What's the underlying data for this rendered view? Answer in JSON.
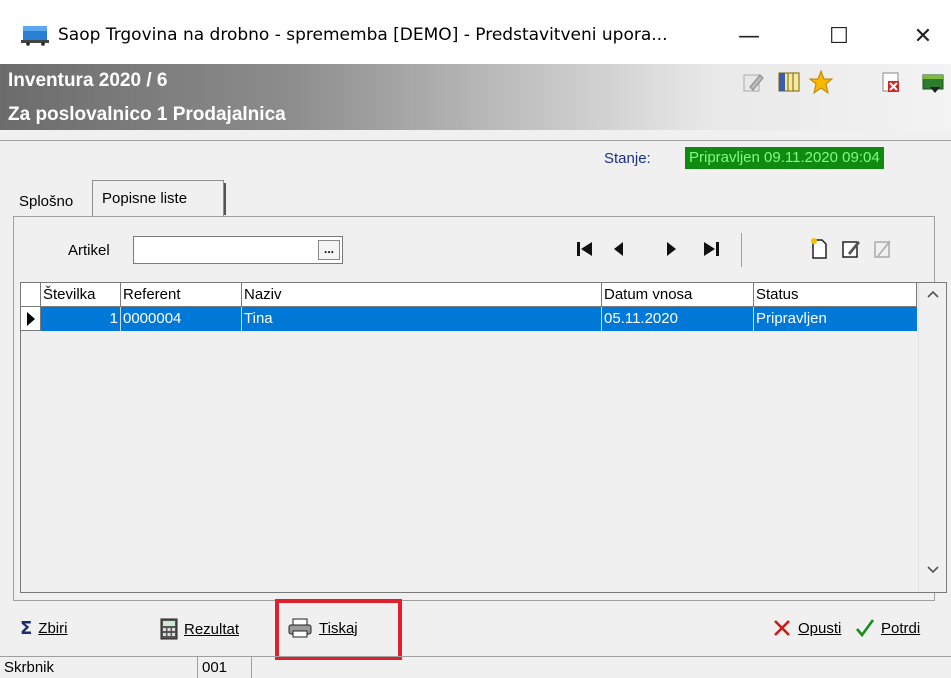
{
  "window": {
    "title": "Saop Trgovina na drobno - sprememba [DEMO] - Predstavitveni upora...",
    "minimize": "—",
    "maximize": "☐",
    "close": "✕"
  },
  "header": {
    "line1": "Inventura 2020 / 6",
    "line2": "Za poslovalnico 1 Prodajalnica",
    "icons": [
      "edit-icon",
      "columns-icon",
      "favorite-star-icon",
      "delete-document-icon",
      "exit-book-icon"
    ]
  },
  "status": {
    "label": "Stanje:",
    "value": "Pripravljen 09.11.2020 09:04"
  },
  "tabs": [
    {
      "label": "Splošno"
    },
    {
      "label": "Popisne liste"
    }
  ],
  "filter": {
    "label": "Artikel",
    "value": "",
    "browse": "..."
  },
  "grid": {
    "columns": [
      "Številka",
      "Referent",
      "Naziv",
      "Datum vnosa",
      "Status"
    ],
    "rows": [
      {
        "stevilka": "1",
        "referent": "0000004",
        "naziv": "Tina",
        "datum": "05.11.2020",
        "status": "Pripravljen"
      }
    ]
  },
  "buttons": {
    "zbiri": "Zbiri",
    "rezultat": "Rezultat",
    "tiskaj": "Tiskaj",
    "opusti": "Opusti",
    "potrdi": "Potrdi"
  },
  "statusbar": {
    "user": "Skrbnik",
    "code": "001"
  },
  "colors": {
    "selection": "#0078d7",
    "status_bg": "#118a11",
    "status_fg": "#7dff7d",
    "highlight": "#e0202a"
  }
}
